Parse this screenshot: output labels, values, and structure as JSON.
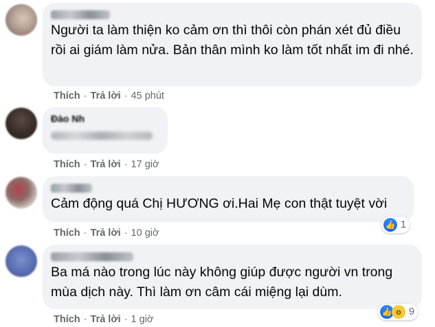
{
  "colors": {
    "bubble": "#f0f2f5",
    "meta": "#65676b",
    "text": "#050505",
    "like": "#0866ff"
  },
  "comments": [
    {
      "author_display": "",
      "text": "Người ta làm thiện ko cảm ơn thì thôi còn phán xét đủ điều rồi ai giám làm nửa. Bản thân mình ko làm tốt nhất im đi nhé.",
      "like": "Thích",
      "reply": "Trả lời",
      "time": "45 phút"
    },
    {
      "author_display": "Đào Nh",
      "text": "",
      "like": "Thích",
      "reply": "Trả lời",
      "time": "17 giờ"
    },
    {
      "author_display": "",
      "text": "Cảm động quá Chị HƯƠNG ơi.Hai Mẹ con thật tuyệt vời",
      "like": "Thích",
      "reply": "Trả lời",
      "time": "10 giờ",
      "reactions": {
        "icons": [
          "like-icon"
        ],
        "count": "1"
      }
    },
    {
      "author_display": "",
      "text": "Ba má nào trong lúc này không giúp được người vn trong mùa dịch này. Thì làm ơn câm cái miệng lại dùm.",
      "like": "Thích",
      "reply": "Trả lời",
      "time": "1 giờ",
      "reactions": {
        "icons": [
          "like-icon",
          "wow-icon"
        ],
        "count": "9"
      }
    }
  ]
}
